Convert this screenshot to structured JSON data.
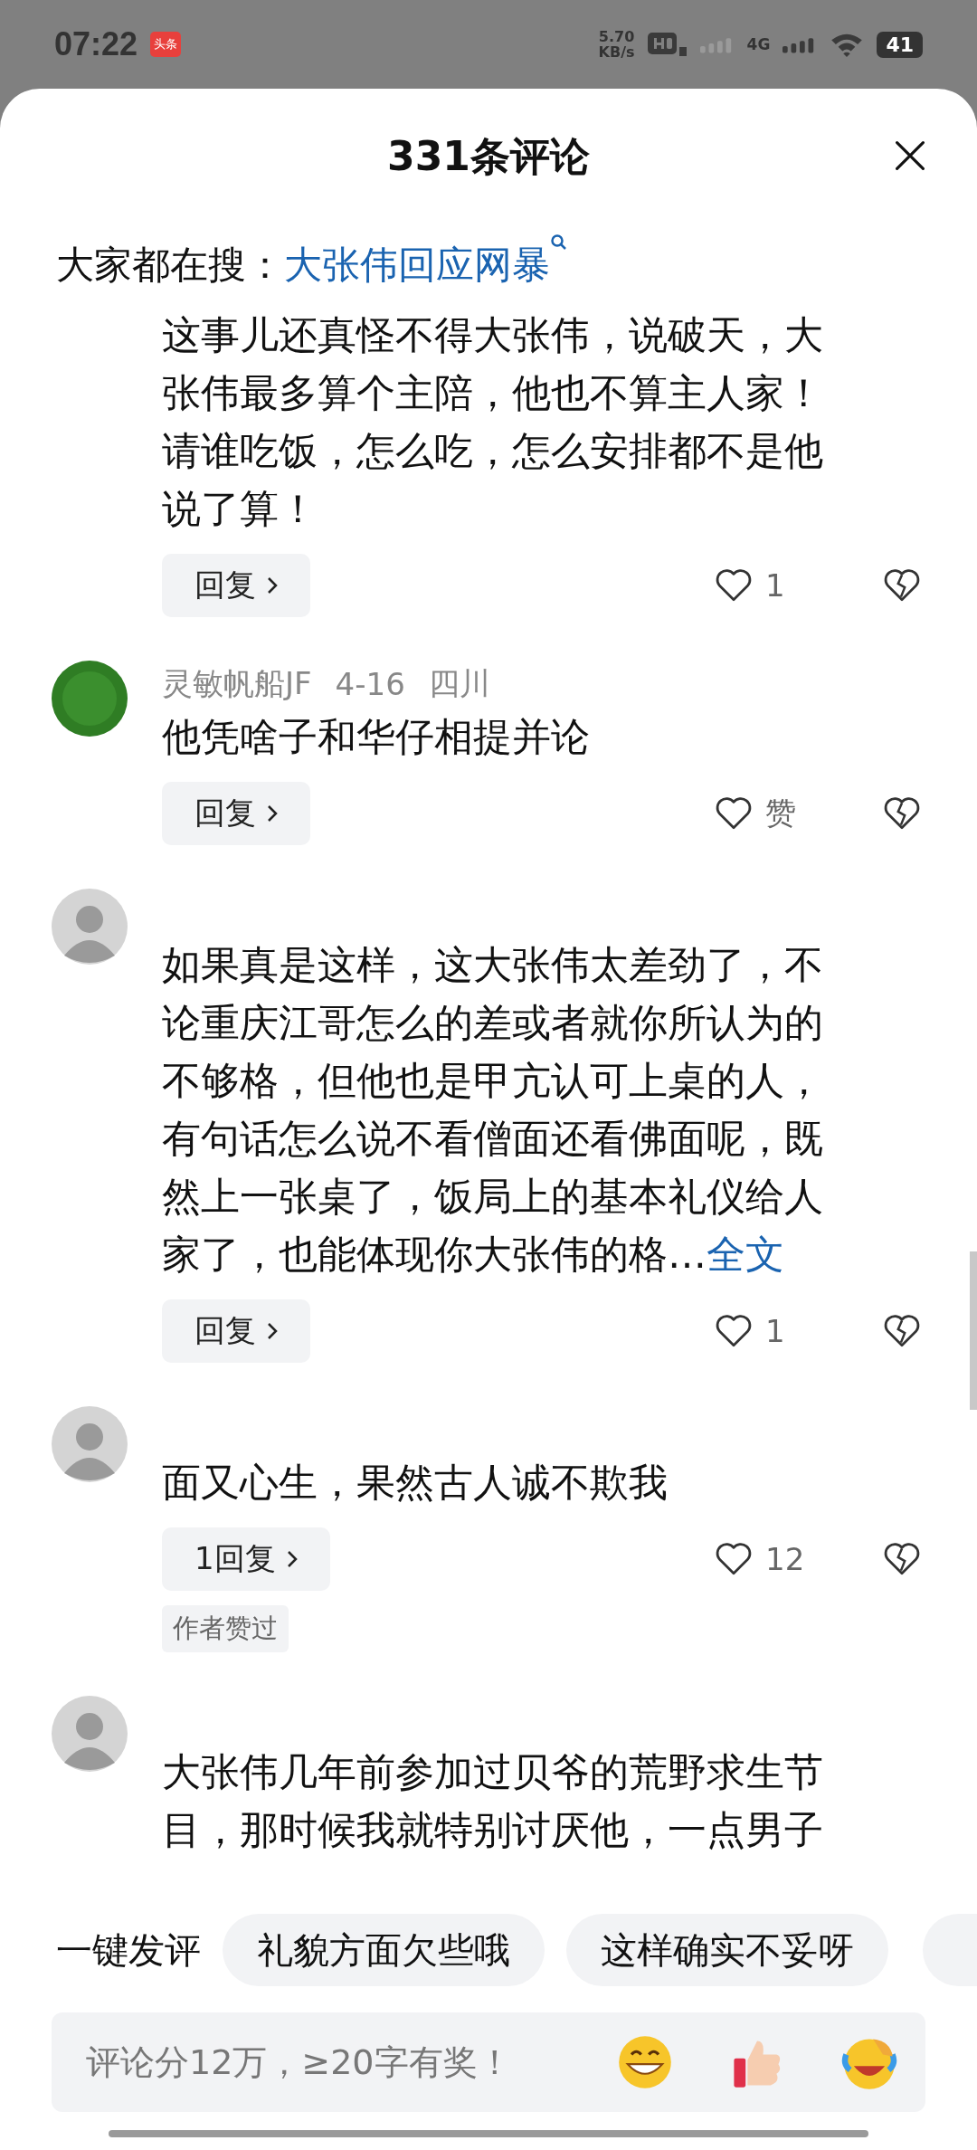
{
  "status_bar": {
    "time": "07:22",
    "app_badge": "头条",
    "speed": "5.70",
    "speed_unit": "KB/s",
    "network": "4G",
    "battery": "41"
  },
  "sheet": {
    "title": "331条评论",
    "hot_search": {
      "label": "大家都在搜：",
      "query": "大张伟回应网暴"
    }
  },
  "comments": [
    {
      "lines": [
        "这事儿还真怪不得大张伟，说破天，大",
        "张伟最多算个主陪，他也不算主人家！",
        "请谁吃饭，怎么吃，怎么安排都不是他",
        "说了算！"
      ],
      "reply": "回复",
      "likes": "1"
    },
    {
      "avatar": {
        "kind": "logo"
      },
      "author": "灵敏帆船JF",
      "date": "4-16",
      "region": "四川",
      "lines": [
        "他凭啥子和华仔相提并论"
      ],
      "reply": "回复",
      "likes": "赞"
    },
    {
      "avatar": {
        "kind": "photo"
      },
      "lines": [
        "如果真是这样，这大张伟太差劲了，不",
        "论重庆江哥怎么的差或者就你所认为的",
        "不够格，但他也是甲亢认可上桌的人，",
        "有句话怎么说不看僧面还看佛面呢，既",
        "然上一张桌了，饭局上的基本礼仪给人",
        "家了，也能体现你大张伟的格…"
      ],
      "more": "全文",
      "reply": "回复",
      "likes": "1"
    },
    {
      "avatar": {
        "kind": "photo"
      },
      "lines": [
        "面又心生，果然古人诚不欺我"
      ],
      "reply": "1回复",
      "likes": "12",
      "tag": "作者赞过"
    },
    {
      "avatar": {
        "kind": "photo"
      },
      "lines": [
        "大张伟几年前参加过贝爷的荒野求生节",
        "目，那时候我就特别讨厌他，一点男子"
      ]
    }
  ],
  "quick_comments": {
    "label": "一键发评",
    "chips": [
      "礼貌方面欠些哦",
      "这样确实不妥呀"
    ]
  },
  "composer": {
    "placeholder": "评论分12万，≥20字有奖！"
  }
}
